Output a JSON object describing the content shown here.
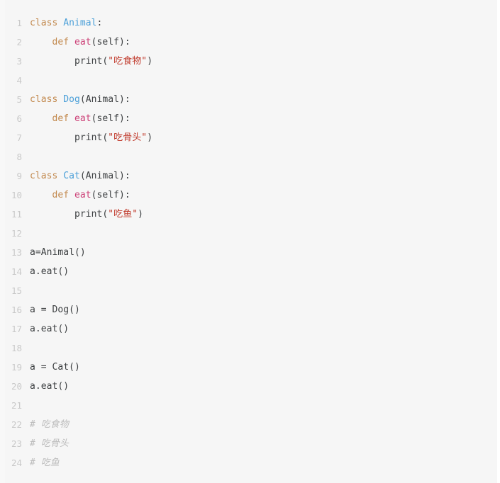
{
  "editor": {
    "language": "python",
    "background_color": "#f6f6f6",
    "line_number_color": "#c9c9c9",
    "total_lines": 24,
    "colors": {
      "keyword": "#c2894e",
      "class_name": "#4a9fd8",
      "function_name": "#cc4077",
      "string": "#c0392b",
      "plain": "#3c3f41",
      "comment": "#bcbcbc"
    }
  },
  "lines": [
    {
      "number": "1",
      "tokens": [
        {
          "text": "class ",
          "type": "kw"
        },
        {
          "text": "Animal",
          "type": "class"
        },
        {
          "text": ":",
          "type": "plain"
        }
      ]
    },
    {
      "number": "2",
      "tokens": [
        {
          "text": "    ",
          "type": "plain"
        },
        {
          "text": "def ",
          "type": "kw"
        },
        {
          "text": "eat",
          "type": "fn"
        },
        {
          "text": "(self):",
          "type": "plain"
        }
      ]
    },
    {
      "number": "3",
      "tokens": [
        {
          "text": "        print(",
          "type": "plain"
        },
        {
          "text": "\"吃食物\"",
          "type": "str"
        },
        {
          "text": ")",
          "type": "plain"
        }
      ]
    },
    {
      "number": "4",
      "tokens": []
    },
    {
      "number": "5",
      "tokens": [
        {
          "text": "class ",
          "type": "kw"
        },
        {
          "text": "Dog",
          "type": "class"
        },
        {
          "text": "(Animal):",
          "type": "plain"
        }
      ]
    },
    {
      "number": "6",
      "tokens": [
        {
          "text": "    ",
          "type": "plain"
        },
        {
          "text": "def ",
          "type": "kw"
        },
        {
          "text": "eat",
          "type": "fn"
        },
        {
          "text": "(self):",
          "type": "plain"
        }
      ]
    },
    {
      "number": "7",
      "tokens": [
        {
          "text": "        print(",
          "type": "plain"
        },
        {
          "text": "\"吃骨头\"",
          "type": "str"
        },
        {
          "text": ")",
          "type": "plain"
        }
      ]
    },
    {
      "number": "8",
      "tokens": []
    },
    {
      "number": "9",
      "tokens": [
        {
          "text": "class ",
          "type": "kw"
        },
        {
          "text": "Cat",
          "type": "class"
        },
        {
          "text": "(Animal):",
          "type": "plain"
        }
      ]
    },
    {
      "number": "10",
      "tokens": [
        {
          "text": "    ",
          "type": "plain"
        },
        {
          "text": "def ",
          "type": "kw"
        },
        {
          "text": "eat",
          "type": "fn"
        },
        {
          "text": "(self):",
          "type": "plain"
        }
      ]
    },
    {
      "number": "11",
      "tokens": [
        {
          "text": "        print(",
          "type": "plain"
        },
        {
          "text": "\"吃鱼\"",
          "type": "str"
        },
        {
          "text": ")",
          "type": "plain"
        }
      ]
    },
    {
      "number": "12",
      "tokens": []
    },
    {
      "number": "13",
      "tokens": [
        {
          "text": "a=Animal()",
          "type": "plain"
        }
      ]
    },
    {
      "number": "14",
      "tokens": [
        {
          "text": "a.eat()",
          "type": "plain"
        }
      ]
    },
    {
      "number": "15",
      "tokens": []
    },
    {
      "number": "16",
      "tokens": [
        {
          "text": "a = Dog()",
          "type": "plain"
        }
      ]
    },
    {
      "number": "17",
      "tokens": [
        {
          "text": "a.eat()",
          "type": "plain"
        }
      ]
    },
    {
      "number": "18",
      "tokens": []
    },
    {
      "number": "19",
      "tokens": [
        {
          "text": "a = Cat()",
          "type": "plain"
        }
      ]
    },
    {
      "number": "20",
      "tokens": [
        {
          "text": "a.eat()",
          "type": "plain"
        }
      ]
    },
    {
      "number": "21",
      "tokens": []
    },
    {
      "number": "22",
      "tokens": [
        {
          "text": "# 吃食物",
          "type": "comment"
        }
      ]
    },
    {
      "number": "23",
      "tokens": [
        {
          "text": "# 吃骨头",
          "type": "comment"
        }
      ]
    },
    {
      "number": "24",
      "tokens": [
        {
          "text": "# 吃鱼",
          "type": "comment"
        }
      ]
    }
  ]
}
